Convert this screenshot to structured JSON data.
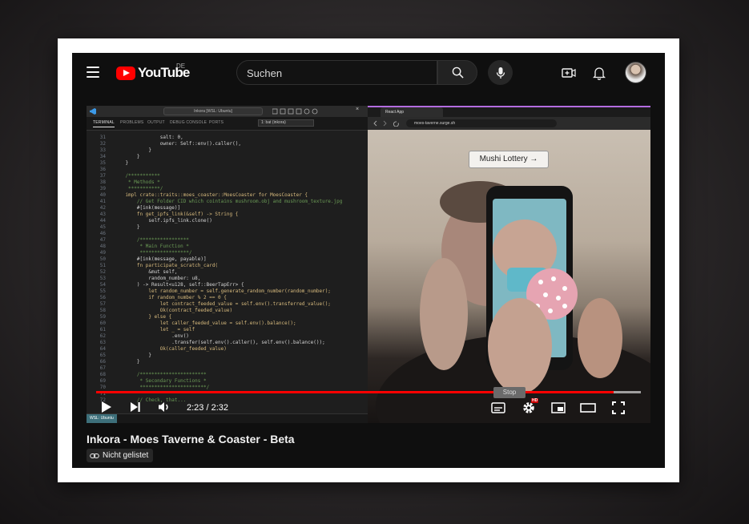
{
  "masthead": {
    "logo_text": "YouTube",
    "region_code": "DE",
    "search_placeholder": "Suchen"
  },
  "player": {
    "progress_fraction": 0.95,
    "time_display": "2:23 / 2:32",
    "badge_hd": "HD",
    "progress_color": "#ff0000"
  },
  "video_frame": {
    "vscode": {
      "command_center": "Inkora [WSL: Ubuntu]",
      "panel_tabs": [
        "TERMINAL",
        "PROBLEMS",
        "OUTPUT",
        "DEBUG CONSOLE",
        "PORTS"
      ],
      "terminal_select": "1: bat (inkora)",
      "status_label": "WSL: Ubuntu",
      "code_lines": [
        {
          "n": "31",
          "text": "                salt: 0,"
        },
        {
          "n": "32",
          "text": "                owner: Self::env().caller(),"
        },
        {
          "n": "33",
          "text": "            }"
        },
        {
          "n": "34",
          "text": "        }"
        },
        {
          "n": "35",
          "text": "    }"
        },
        {
          "n": "36",
          "text": ""
        },
        {
          "n": "37",
          "text": "    /***********"
        },
        {
          "n": "38",
          "text": "     * Methods *"
        },
        {
          "n": "39",
          "text": "     ***********/"
        },
        {
          "n": "40",
          "text": "    impl crate::traits::moes_coaster::MoesCoaster for MoesCoaster {"
        },
        {
          "n": "41",
          "text": "        // Get Folder CID which cointains mushroom.obj and mushroom_texture.jpg"
        },
        {
          "n": "42",
          "text": "        #[ink(message)]"
        },
        {
          "n": "43",
          "text": "        fn get_ipfs_link(&self) -> String {"
        },
        {
          "n": "44",
          "text": "            self.ipfs_link.clone()"
        },
        {
          "n": "45",
          "text": "        }"
        },
        {
          "n": "46",
          "text": ""
        },
        {
          "n": "47",
          "text": "        /*****************"
        },
        {
          "n": "48",
          "text": "         * Main Function *"
        },
        {
          "n": "49",
          "text": "         *****************/"
        },
        {
          "n": "50",
          "text": "        #[ink(message, payable)]"
        },
        {
          "n": "51",
          "text": "        fn participate_scratch_card("
        },
        {
          "n": "52",
          "text": "            &mut self,"
        },
        {
          "n": "53",
          "text": "            random_number: u8,"
        },
        {
          "n": "54",
          "text": "        ) -> Result<u128, self::BeerTapErr> {"
        },
        {
          "n": "55",
          "text": "            let random_number = self.generate_random_number(random_number);"
        },
        {
          "n": "56",
          "text": "            if random_number % 2 == 0 {"
        },
        {
          "n": "57",
          "text": "                let contract_feeded_value = self.env().transferred_value();"
        },
        {
          "n": "58",
          "text": "                Ok(contract_feeded_value)"
        },
        {
          "n": "59",
          "text": "            } else {"
        },
        {
          "n": "60",
          "text": "                let caller_feeded_value = self.env().balance();"
        },
        {
          "n": "61",
          "text": "                let _ = self"
        },
        {
          "n": "62",
          "text": "                    .env()"
        },
        {
          "n": "63",
          "text": "                    .transfer(self.env().caller(), self.env().balance());"
        },
        {
          "n": "64",
          "text": "                Ok(caller_feeded_value)"
        },
        {
          "n": "65",
          "text": "            }"
        },
        {
          "n": "66",
          "text": "        }"
        },
        {
          "n": "67",
          "text": ""
        },
        {
          "n": "68",
          "text": "        /***********************"
        },
        {
          "n": "69",
          "text": "         * Secondary Functions *"
        },
        {
          "n": "70",
          "text": "         ***********************/"
        },
        {
          "n": "71",
          "text": ""
        },
        {
          "n": "72",
          "text": "        // Check, that..."
        }
      ]
    },
    "browser": {
      "tab_title": "React App",
      "address": "moes-taverne.surge.sh",
      "lottery_button": "Mushi Lottery →",
      "stop_label": "Stop"
    }
  },
  "below": {
    "title": "Inkora - Moes Taverne & Coaster - Beta",
    "visibility": "Nicht gelistet"
  }
}
